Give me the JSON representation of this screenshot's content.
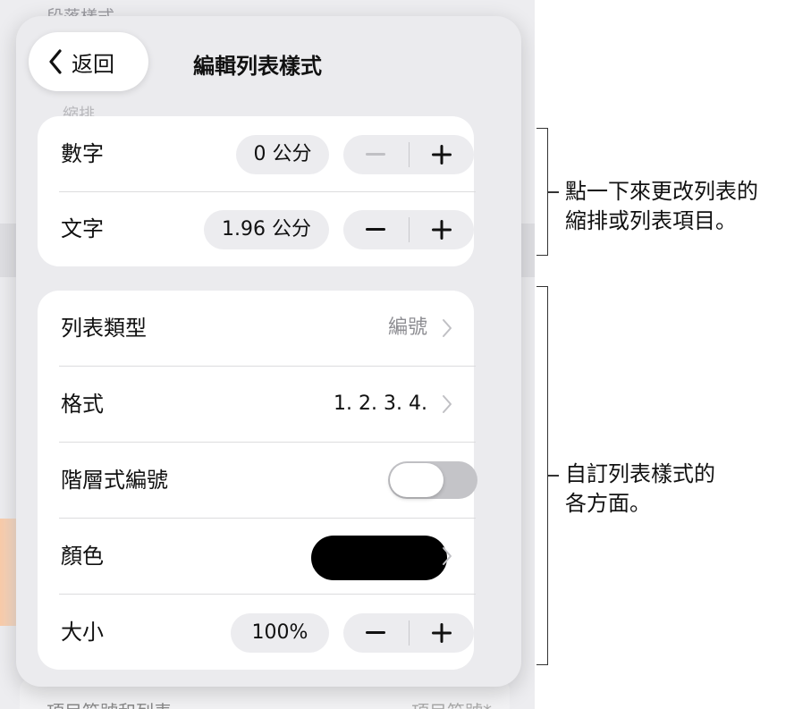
{
  "background": {
    "heading": "段落樣式",
    "footer_label": "項目符號和列表",
    "footer_value": "項目符號*",
    "ghost_label": "縮排"
  },
  "nav": {
    "back_label": "返回",
    "title": "編輯列表樣式"
  },
  "indent": {
    "number": {
      "label": "數字",
      "value": "0 公分"
    },
    "text": {
      "label": "文字",
      "value": "1.96 公分"
    }
  },
  "list": {
    "type": {
      "label": "列表類型",
      "value": "編號"
    },
    "format": {
      "label": "格式",
      "value": "1. 2. 3. 4."
    },
    "tiered": {
      "label": "階層式編號",
      "on": false
    },
    "color": {
      "label": "顏色",
      "value": "#000000"
    },
    "size": {
      "label": "大小",
      "value": "100%"
    }
  },
  "callouts": {
    "indent": [
      "點一下來更改列表的",
      "縮排或列表項目。"
    ],
    "aspects": [
      "自訂列表樣式的",
      "各方面。"
    ]
  },
  "colors": {
    "accent_disabled": "#c0c0c4",
    "text": "#111111",
    "value_grey": "#8e8e93"
  }
}
